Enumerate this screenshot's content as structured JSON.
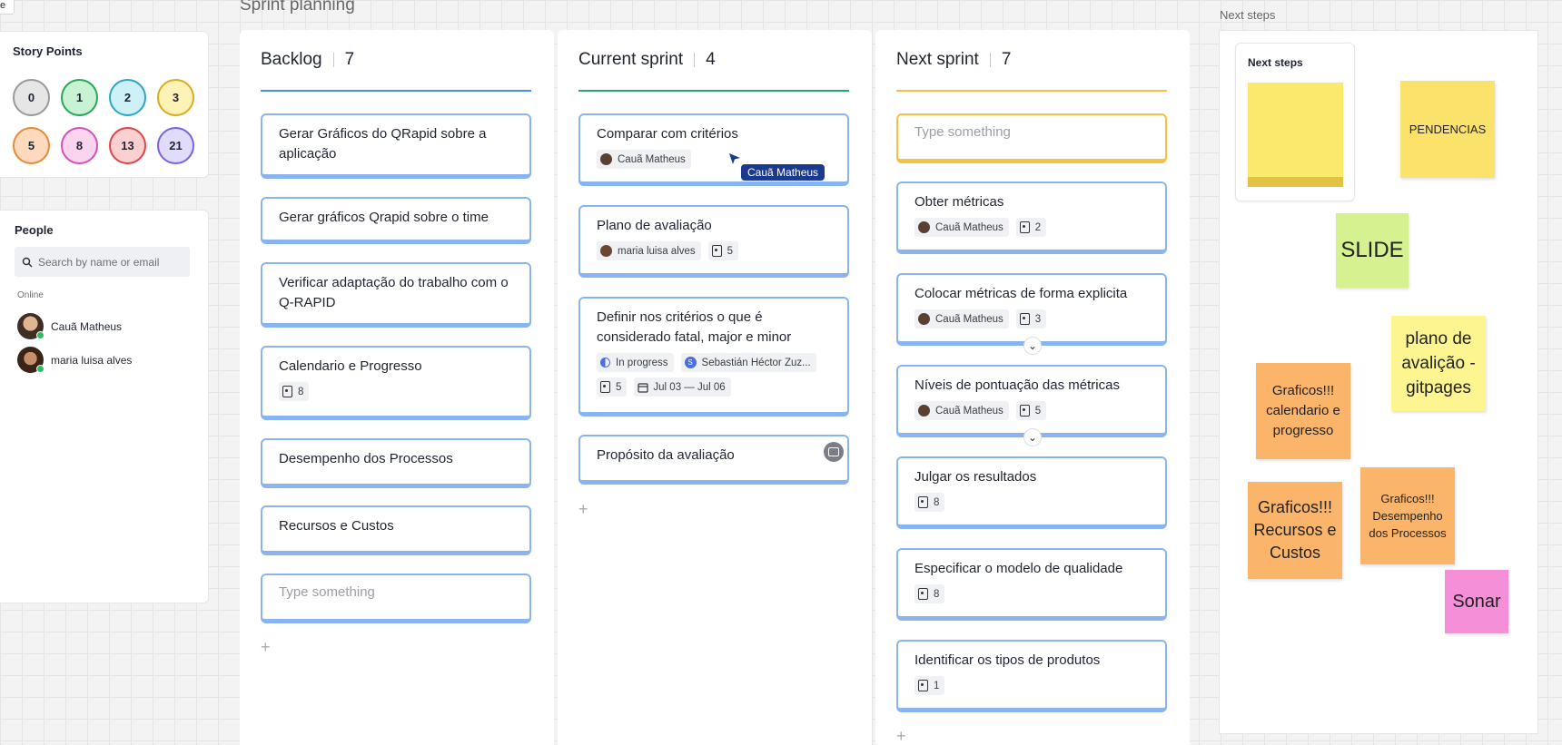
{
  "corner": {
    "label": "e"
  },
  "board": {
    "title": "Sprint planning"
  },
  "story_points": {
    "title": "Story Points",
    "values": [
      {
        "label": "0",
        "bg": "#e6e6e6",
        "border": "#9a9a9a"
      },
      {
        "label": "1",
        "bg": "#c9f2d4",
        "border": "#26a854"
      },
      {
        "label": "2",
        "bg": "#cdf1f7",
        "border": "#2aa6c4"
      },
      {
        "label": "3",
        "bg": "#fdf3b6",
        "border": "#d9ac20"
      },
      {
        "label": "5",
        "bg": "#fdd9bd",
        "border": "#e58a3a"
      },
      {
        "label": "8",
        "bg": "#fbd4ef",
        "border": "#d152b5"
      },
      {
        "label": "13",
        "bg": "#fcd0d0",
        "border": "#d9464a"
      },
      {
        "label": "21",
        "bg": "#e1dcfb",
        "border": "#7b61e0"
      }
    ]
  },
  "people": {
    "title": "People",
    "search_placeholder": "Search by name or email",
    "online_label": "Online",
    "users": [
      {
        "name": "Cauã Matheus"
      },
      {
        "name": "maria luisa alves"
      }
    ]
  },
  "columns": {
    "backlog": {
      "name": "Backlog",
      "count": "7",
      "color": "#4a90e2",
      "cards": [
        {
          "title": "Gerar Gráficos do QRapid sobre a aplicação"
        },
        {
          "title": "Gerar gráficos Qrapid sobre o time"
        },
        {
          "title": "Verificar adaptação do trabalho com o Q-RAPID"
        },
        {
          "title": "Calendario e Progresso",
          "points": "8"
        },
        {
          "title": "Desempenho dos Processos"
        },
        {
          "title": "Recursos e Custos"
        }
      ],
      "placeholder": "Type something"
    },
    "current": {
      "name": "Current sprint",
      "count": "4",
      "color": "#26a37a",
      "cards": [
        {
          "title": "Comparar com critérios",
          "assignee": "Cauã Matheus"
        },
        {
          "title": "Plano de avaliação",
          "assignee": "maria luisa alves",
          "points": "5"
        },
        {
          "title": "Definir nos critérios o que é considerado fatal, major e minor",
          "status": "In progress",
          "assignee": "Sebastián Héctor Zuz...",
          "points": "5",
          "dates": "Jul 03 — Jul 06"
        },
        {
          "title": "Propósito da avaliação"
        }
      ],
      "cursor_label": "Cauã Matheus"
    },
    "next": {
      "name": "Next sprint",
      "count": "7",
      "color": "#f5c242",
      "placeholder": "Type something",
      "cards": [
        {
          "title": "Obter métricas",
          "assignee": "Cauã Matheus",
          "points": "2"
        },
        {
          "title": "Colocar métricas de forma explicita",
          "assignee": "Cauã Matheus",
          "points": "3"
        },
        {
          "title": "Níveis de pontuação das métricas",
          "assignee": "Cauã Matheus",
          "points": "5"
        },
        {
          "title": "Julgar os resultados",
          "points": "8"
        },
        {
          "title": "Especificar o modelo de qualidade",
          "points": "8"
        },
        {
          "title": "Identificar os tipos de produtos",
          "points": "1"
        }
      ]
    }
  },
  "next_steps": {
    "frame_label": "Next steps",
    "card_title": "Next steps",
    "stickies": {
      "pendencias": "PENDENCIAS",
      "slide": "SLIDE",
      "plano": "plano de avalição -gitpages",
      "graf_cal": "Graficos!!! calendario e progresso",
      "graf_rec": "Graficos!!! Recursos e Custos",
      "graf_des": "Graficos!!! Desempenho dos Processos",
      "sonar": "Sonar"
    }
  },
  "colors": {
    "sticky_yellow": "#fbe36b",
    "sticky_light_yellow": "#fdf58f",
    "sticky_green": "#d6f18f",
    "sticky_orange": "#fbb56a",
    "sticky_pink": "#f590d8",
    "card_border": "#8ab4f0"
  }
}
